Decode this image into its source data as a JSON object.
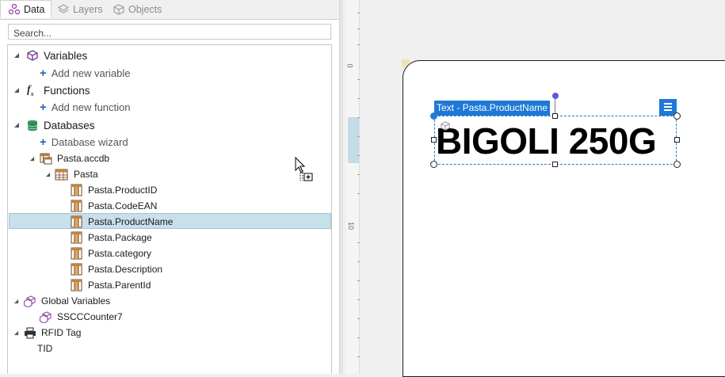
{
  "tabs": [
    {
      "label": "Data",
      "icon": "data-sources-icon",
      "active": true
    },
    {
      "label": "Layers",
      "icon": "layers-icon",
      "active": false
    },
    {
      "label": "Objects",
      "icon": "objects-icon",
      "active": false
    }
  ],
  "search": {
    "placeholder": "Search..."
  },
  "tree": {
    "variables": {
      "label": "Variables",
      "add": "Add new variable"
    },
    "functions": {
      "label": "Functions",
      "add": "Add new function"
    },
    "databases": {
      "label": "Databases",
      "add": "Database wizard"
    },
    "db_file": "Pasta.accdb",
    "table": "Pasta",
    "fields": [
      "Pasta.ProductID",
      "Pasta.CodeEAN",
      "Pasta.ProductName",
      "Pasta.Package",
      "Pasta.category",
      "Pasta.Description",
      "Pasta.ParentId"
    ],
    "selected_field": "Pasta.ProductName",
    "global_variables": {
      "label": "Global Variables",
      "items": [
        "SSCCCounter7"
      ]
    },
    "rfid": {
      "label": "RFID Tag",
      "items": [
        "TID"
      ]
    }
  },
  "ruler": {
    "labels": [
      "0",
      "10"
    ]
  },
  "design": {
    "selection_label": "Text - Pasta.ProductName",
    "text_value": "BIGOLI 250G"
  },
  "colors": {
    "selection": "#1e78d6",
    "tree_highlight": "#c7e0ea",
    "icon_purple": "#7a3d8f",
    "icon_green": "#3aa06a"
  }
}
